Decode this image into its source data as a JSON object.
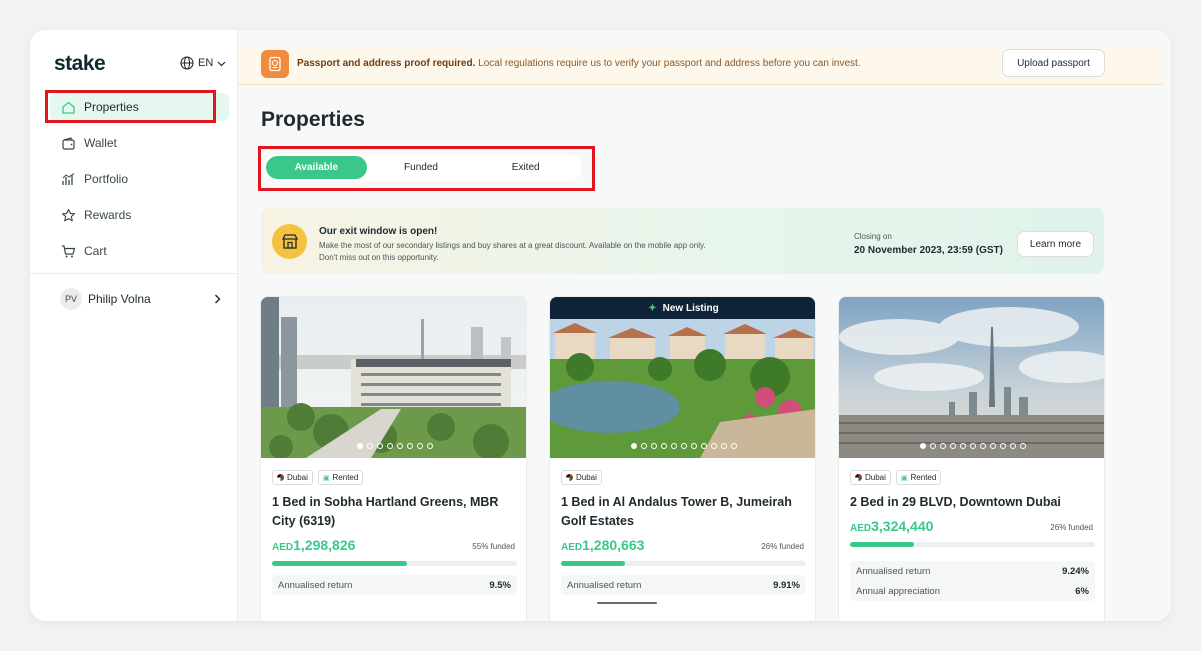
{
  "app": {
    "logo": "stake",
    "language": "EN"
  },
  "sidebar": {
    "items": [
      {
        "label": "Properties",
        "icon": "home-icon",
        "active": true
      },
      {
        "label": "Wallet",
        "icon": "wallet-icon",
        "active": false
      },
      {
        "label": "Portfolio",
        "icon": "chart-icon",
        "active": false
      },
      {
        "label": "Rewards",
        "icon": "star-icon",
        "active": false
      },
      {
        "label": "Cart",
        "icon": "cart-icon",
        "active": false
      }
    ],
    "user": {
      "initials": "PV",
      "name": "Philip Volna"
    }
  },
  "banner": {
    "bold": "Passport and address proof required.",
    "text": " Local regulations require us to verify your passport and address before you can invest.",
    "button": "Upload passport"
  },
  "page": {
    "title": "Properties"
  },
  "tabs": [
    {
      "label": "Available",
      "active": true
    },
    {
      "label": "Funded",
      "active": false
    },
    {
      "label": "Exited",
      "active": false
    }
  ],
  "exit_window": {
    "title": "Our exit window is open!",
    "line1": "Make the most of our secondary listings and buy shares at a great discount. Available on the mobile app only.",
    "line2": "Don't miss out on this opportunity.",
    "closing_label": "Closing on",
    "closing_date": "20 November 2023, 23:59 (GST)",
    "button": "Learn more"
  },
  "properties": [
    {
      "badge": "",
      "tags": [
        "Dubai",
        "Rented"
      ],
      "title": "1 Bed in Sobha Hartland Greens, MBR City (6319)",
      "currency": "AED",
      "price": "1,298,826",
      "funded_text": "55% funded",
      "funded_fraction": 0.55,
      "stats": [
        {
          "label": "Annualised return",
          "value": "9.5%"
        }
      ]
    },
    {
      "badge": "New Listing",
      "tags": [
        "Dubai"
      ],
      "title": "1 Bed in Al Andalus Tower B, Jumeirah Golf Estates",
      "currency": "AED",
      "price": "1,280,663",
      "funded_text": "26% funded",
      "funded_fraction": 0.26,
      "stats": [
        {
          "label": "Annualised return",
          "value": "9.91%"
        }
      ]
    },
    {
      "badge": "",
      "tags": [
        "Dubai",
        "Rented"
      ],
      "title": "2 Bed in 29 BLVD, Downtown Dubai",
      "currency": "AED",
      "price": "3,324,440",
      "funded_text": "26% funded",
      "funded_fraction": 0.26,
      "stats": [
        {
          "label": "Annualised return",
          "value": "9.24%"
        },
        {
          "label": "Annual appreciation",
          "value": "6%"
        }
      ]
    }
  ],
  "colors": {
    "accent": "#39c88a",
    "highlight": "#e2141c",
    "banner_bg": "#fdf7ec",
    "banner_icon": "#ef8a3e",
    "exit_icon": "#f4c23f"
  }
}
